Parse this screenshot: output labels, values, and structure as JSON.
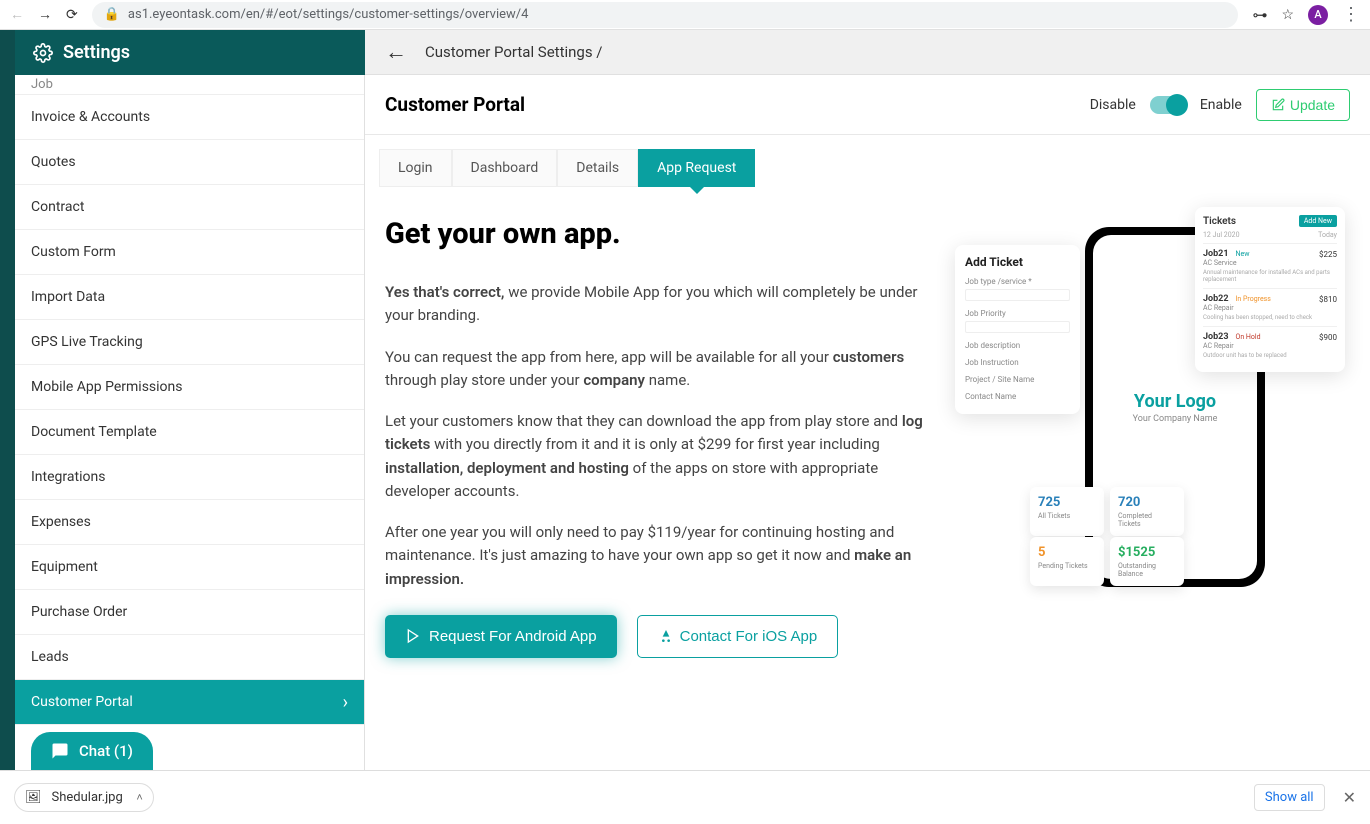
{
  "browser": {
    "url": "as1.eyeontask.com/en/#/eot/settings/customer-settings/overview/4",
    "avatar_letter": "A"
  },
  "sidebar": {
    "title": "Settings",
    "items": [
      {
        "label": "Job"
      },
      {
        "label": "Invoice & Accounts"
      },
      {
        "label": "Quotes"
      },
      {
        "label": "Contract"
      },
      {
        "label": "Custom Form"
      },
      {
        "label": "Import Data"
      },
      {
        "label": "GPS Live Tracking"
      },
      {
        "label": "Mobile App Permissions"
      },
      {
        "label": "Document Template"
      },
      {
        "label": "Integrations"
      },
      {
        "label": "Expenses"
      },
      {
        "label": "Equipment"
      },
      {
        "label": "Purchase Order"
      },
      {
        "label": "Leads"
      },
      {
        "label": "Customer Portal",
        "active": true
      }
    ],
    "chat_label": "Chat (1)"
  },
  "topbar": {
    "breadcrumb": "Customer Portal Settings /"
  },
  "header": {
    "title": "Customer Portal",
    "disable": "Disable",
    "enable": "Enable",
    "update": "Update"
  },
  "tabs": [
    {
      "label": "Login"
    },
    {
      "label": "Dashboard"
    },
    {
      "label": "Details"
    },
    {
      "label": "App Request",
      "active": true
    }
  ],
  "content": {
    "headline": "Get your own app.",
    "p1_bold": "Yes that's correct,",
    "p1_rest": " we provide Mobile App for you which will completely be under your branding.",
    "p2_a": "You can request the app from here, app will be available for all your ",
    "p2_b": "customers",
    "p2_c": " through play store under your ",
    "p2_d": "company",
    "p2_e": " name.",
    "p3_a": "Let your customers know that they can download the app from play store and ",
    "p3_b": "log tickets",
    "p3_c": " with you directly from it and it is only at $299 for first year including ",
    "p3_d": "installation, deployment and hosting",
    "p3_e": " of the apps on store with appropriate developer accounts.",
    "p4_a": "After one year you will only need to pay $119/year for continuing hosting and maintenance. It's just amazing to have your own app so get it now and ",
    "p4_b": "make an impression.",
    "cta_android": "Request For Android App",
    "cta_ios": "Contact For iOS App"
  },
  "mock": {
    "phone_logo": "Your Logo",
    "phone_sub": "Your Company Name",
    "addticket_title": "Add Ticket",
    "f1": "Job type /service *",
    "f2": "Job Priority",
    "f3": "Job description",
    "f4": "Job Instruction",
    "f5": "Project / Site Name",
    "f6": "Contact Name",
    "tickets_title": "Tickets",
    "tickets_btn": "Add New",
    "tickets_date": "12 Jul 2020",
    "tickets_today": "Today",
    "t1_name": "Job21",
    "t1_status": "New",
    "t1_price": "$225",
    "t1_type": "AC Service",
    "t1_desc": "Annual maintenance for installed ACs and parts replacement",
    "t2_name": "Job22",
    "t2_status": "In Progress",
    "t2_price": "$810",
    "t2_type": "AC Repair",
    "t2_desc": "Cooling has been stopped, need to check",
    "t3_name": "Job23",
    "t3_status": "On Hold",
    "t3_price": "$900",
    "t3_type": "AC Repair",
    "t3_desc": "Outdoor unit has to be replaced",
    "s1_num": "725",
    "s1_lbl": "All Tickets",
    "s2_num": "720",
    "s2_lbl": "Completed Tickets",
    "s3_num": "5",
    "s3_lbl": "Pending Tickets",
    "s4_num": "$1525",
    "s4_lbl": "Outstanding Balance"
  },
  "download": {
    "file": "Shedular.jpg",
    "show_all": "Show all"
  }
}
